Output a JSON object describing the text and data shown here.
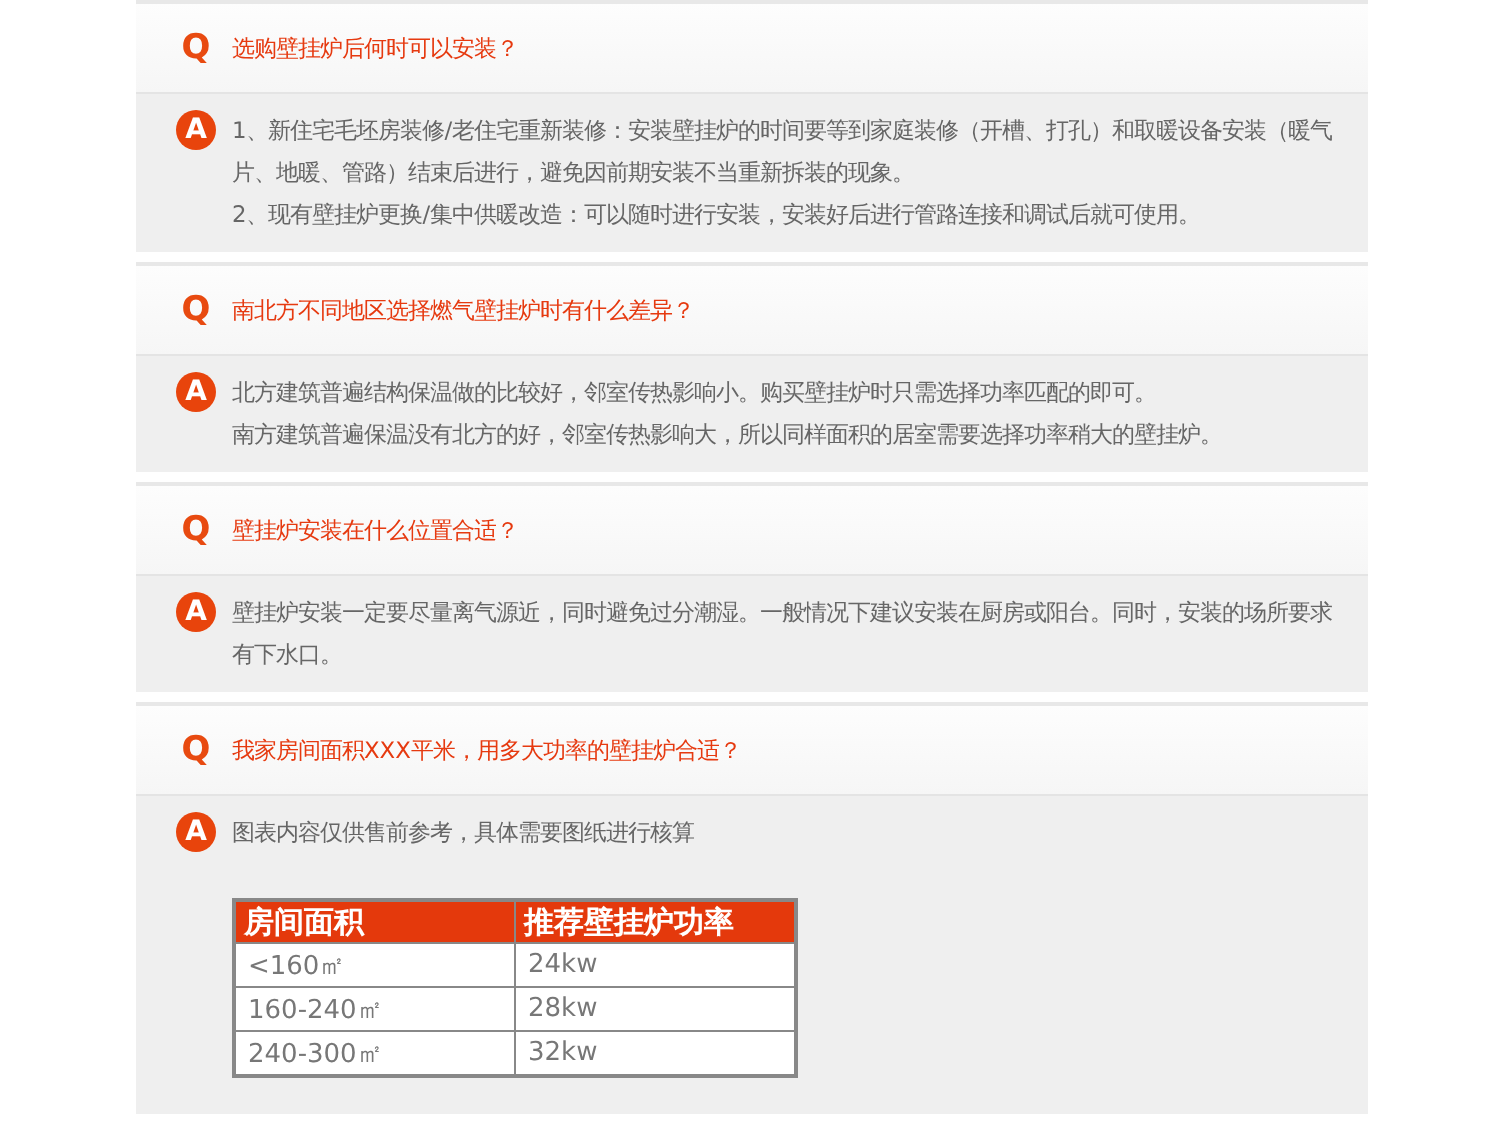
{
  "faqs": [
    {
      "q_mark": "Q",
      "a_mark": "A",
      "question": "选购壁挂炉后何时可以安装？",
      "answer": [
        "1、新住宅毛坯房装修/老住宅重新装修：安装壁挂炉的时间要等到家庭装修（开槽、打孔）和取暖设备安装（暖气片、地暖、管路）结束后进行，避免因前期安装不当重新拆装的现象。",
        "2、现有壁挂炉更换/集中供暖改造：可以随时进行安装，安装好后进行管路连接和调试后就可使用。"
      ]
    },
    {
      "q_mark": "Q",
      "a_mark": "A",
      "question": "南北方不同地区选择燃气壁挂炉时有什么差异？",
      "answer": [
        "北方建筑普遍结构保温做的比较好，邻室传热影响小。购买壁挂炉时只需选择功率匹配的即可。",
        "南方建筑普遍保温没有北方的好，邻室传热影响大，所以同样面积的居室需要选择功率稍大的壁挂炉。"
      ]
    },
    {
      "q_mark": "Q",
      "a_mark": "A",
      "question": "壁挂炉安装在什么位置合适？",
      "answer": [
        "壁挂炉安装一定要尽量离气源近，同时避免过分潮湿。一般情况下建议安装在厨房或阳台。同时，安装的场所要求有下水口。"
      ]
    },
    {
      "q_mark": "Q",
      "a_mark": "A",
      "question": "我家房间面积XXX平米，用多大功率的壁挂炉合适？",
      "answer": [
        "图表内容仅供售前参考，具体需要图纸进行核算"
      ],
      "table": {
        "columns": [
          "房间面积",
          "推荐壁挂炉功率"
        ],
        "rows": [
          [
            "<160㎡",
            "24kw"
          ],
          [
            "160-240㎡",
            "28kw"
          ],
          [
            "240-300㎡",
            "32kw"
          ]
        ]
      }
    }
  ]
}
